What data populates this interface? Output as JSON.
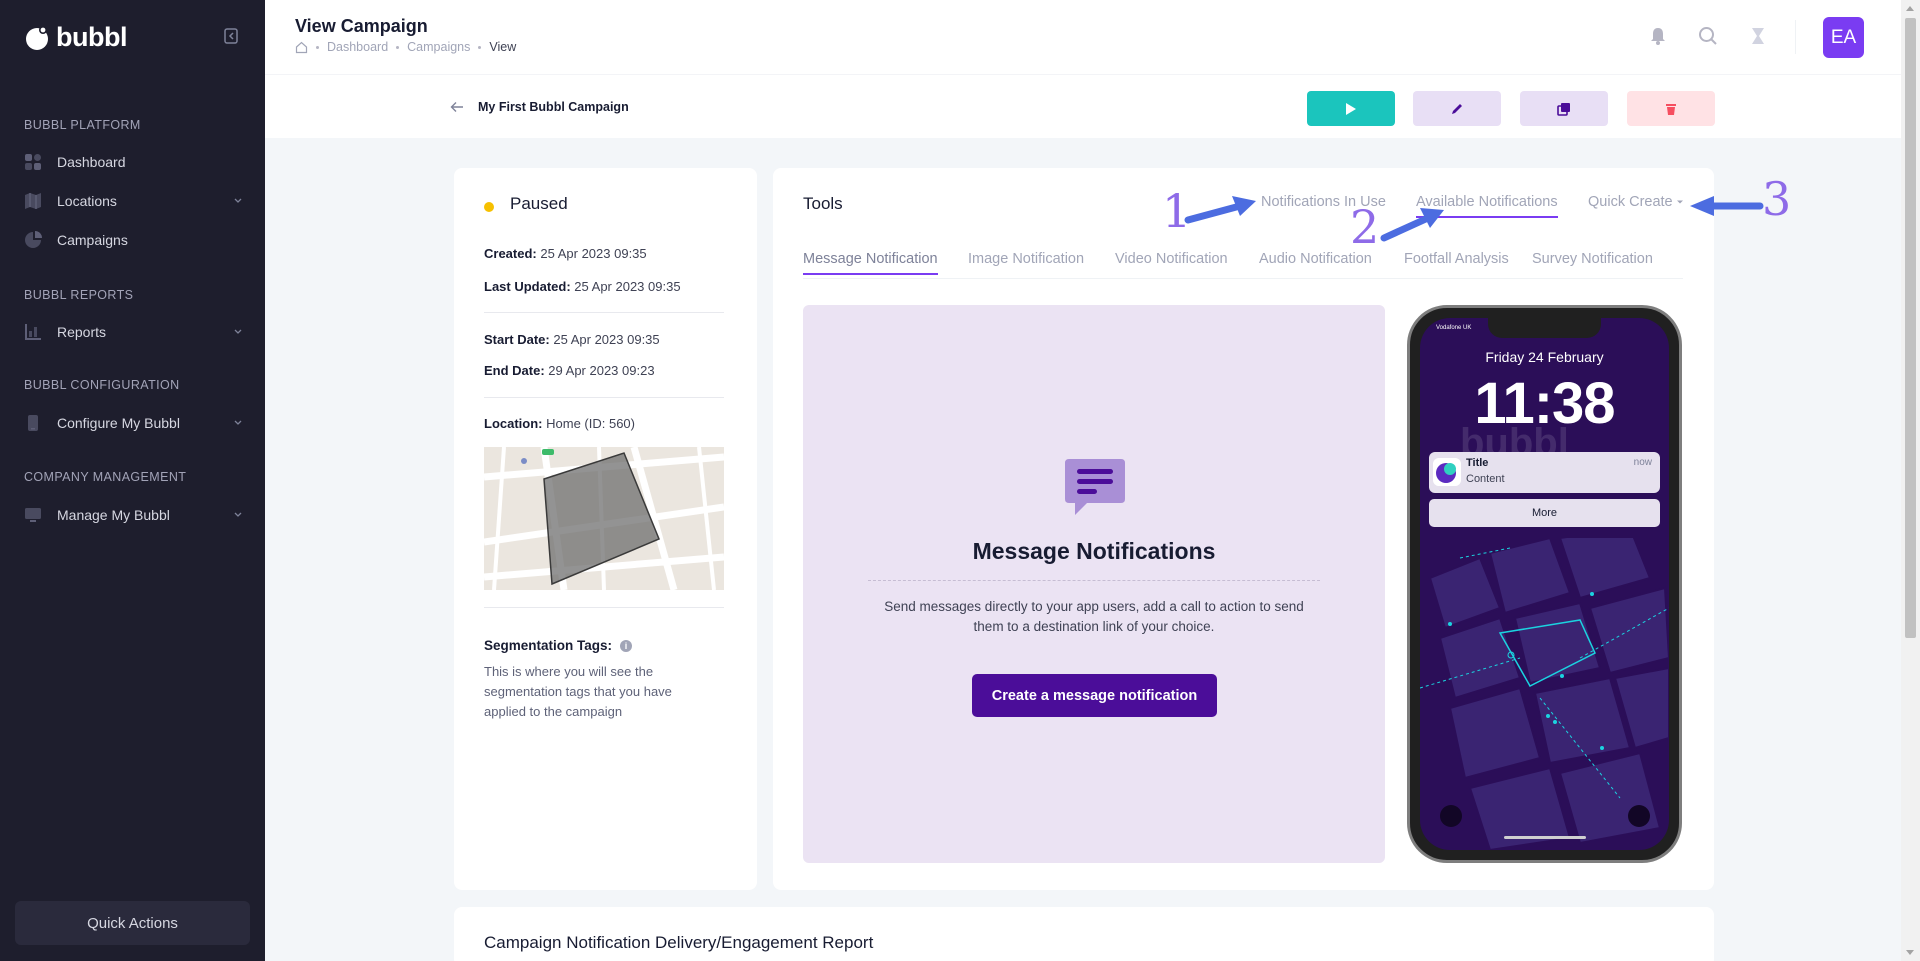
{
  "sidebar": {
    "logo_text": "bubbl",
    "sections": [
      {
        "title": "BUBBL PLATFORM"
      },
      {
        "title": "BUBBL REPORTS"
      },
      {
        "title": "BUBBL CONFIGURATION"
      },
      {
        "title": "COMPANY MANAGEMENT"
      }
    ],
    "items": [
      {
        "label": "Dashboard",
        "icon": "dashboard-icon"
      },
      {
        "label": "Locations",
        "icon": "map-icon"
      },
      {
        "label": "Campaigns",
        "icon": "pie-icon"
      },
      {
        "label": "Reports",
        "icon": "chart-icon"
      },
      {
        "label": "Configure My Bubbl",
        "icon": "phone-icon"
      },
      {
        "label": "Manage My Bubbl",
        "icon": "monitor-icon"
      }
    ],
    "quick_actions": "Quick Actions"
  },
  "header": {
    "title": "View Campaign",
    "breadcrumb": [
      "Dashboard",
      "Campaigns",
      "View"
    ],
    "avatar": "EA"
  },
  "toolbar": {
    "campaign_name": "My First Bubbl Campaign",
    "colors": {
      "play": "#1bc5bd",
      "edit": "#e8dff5",
      "copy": "#e8dff5",
      "delete": "#ffe2e5"
    }
  },
  "details": {
    "status": "Paused",
    "created_label": "Created:",
    "created": "25 Apr 2023 09:35",
    "updated_label": "Last Updated:",
    "updated": "25 Apr 2023 09:35",
    "start_label": "Start Date:",
    "start": "25 Apr 2023 09:35",
    "end_label": "End Date:",
    "end": "29 Apr 2023 09:23",
    "location_label": "Location:",
    "location": "Home (ID: 560)",
    "seg_title": "Segmentation Tags:",
    "seg_desc": "This is where you will see the segmentation tags that you have applied to the campaign"
  },
  "tools": {
    "title": "Tools",
    "top_tabs": [
      "Notifications In Use",
      "Available Notifications",
      "Quick Create"
    ],
    "sub_tabs": [
      "Message Notification",
      "Image Notification",
      "Video Notification",
      "Audio Notification",
      "Footfall Analysis",
      "Survey Notification"
    ],
    "panel_title": "Message Notifications",
    "panel_desc": "Send messages directly to your app users, add a call to action to send them to a destination link of your choice.",
    "create_button": "Create a message notification"
  },
  "phone": {
    "carrier": "Vodafone UK",
    "date": "Friday 24 February",
    "time": "11:38",
    "watermark": "bubbl",
    "notif_title": "Title",
    "notif_content": "Content",
    "notif_time": "now",
    "more": "More"
  },
  "annotations": [
    "1",
    "2",
    "3"
  ],
  "report": {
    "title": "Campaign Notification Delivery/Engagement Report"
  }
}
